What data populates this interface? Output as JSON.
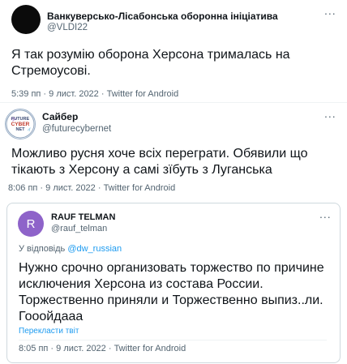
{
  "tweets": [
    {
      "name": "Ванкуверсько-Лісабонська оборонна ініціатива",
      "handle": "@VLDI22",
      "text_lines": [
        "Я так розумію оборона Херсона трималась на",
        "Стремоусові."
      ],
      "meta": "5:39 пп · 9 лист. 2022 · Twitter for Android",
      "more": "..."
    },
    {
      "name": "Сайбер",
      "handle": "@futurecybernet",
      "avatar_lines": [
        "FUTURE",
        "CYBER",
        "NET"
      ],
      "text_lines": [
        "Можливо русня хоче всіх переграти. Обявили що",
        "тікають з Херсону а самі зїбуть з Луганська"
      ],
      "meta": "8:06 пп · 9 лист. 2022 · Twitter for Android",
      "more": "..."
    },
    {
      "name": "RAUF TELMAN",
      "handle": "@rauf_telman",
      "avatar_letter": "R",
      "reply_prefix": "У відповідь",
      "reply_to": "@dw_russian",
      "text_lines": [
        "Нужно срочно организовать торжество по причине",
        "исключения Херсона из состава России.",
        "Торжественно приняли и Торжественно выпиз..ли.",
        "Гооойдааа"
      ],
      "translate": "Перекласти твіт",
      "meta": "8:05 пп · 9 лист. 2022 · Twitter for Android",
      "more": "..."
    }
  ],
  "colors": {
    "link": "#1d9bf0",
    "secondary": "#536471",
    "avatar_rauf": "#8e63c9"
  }
}
